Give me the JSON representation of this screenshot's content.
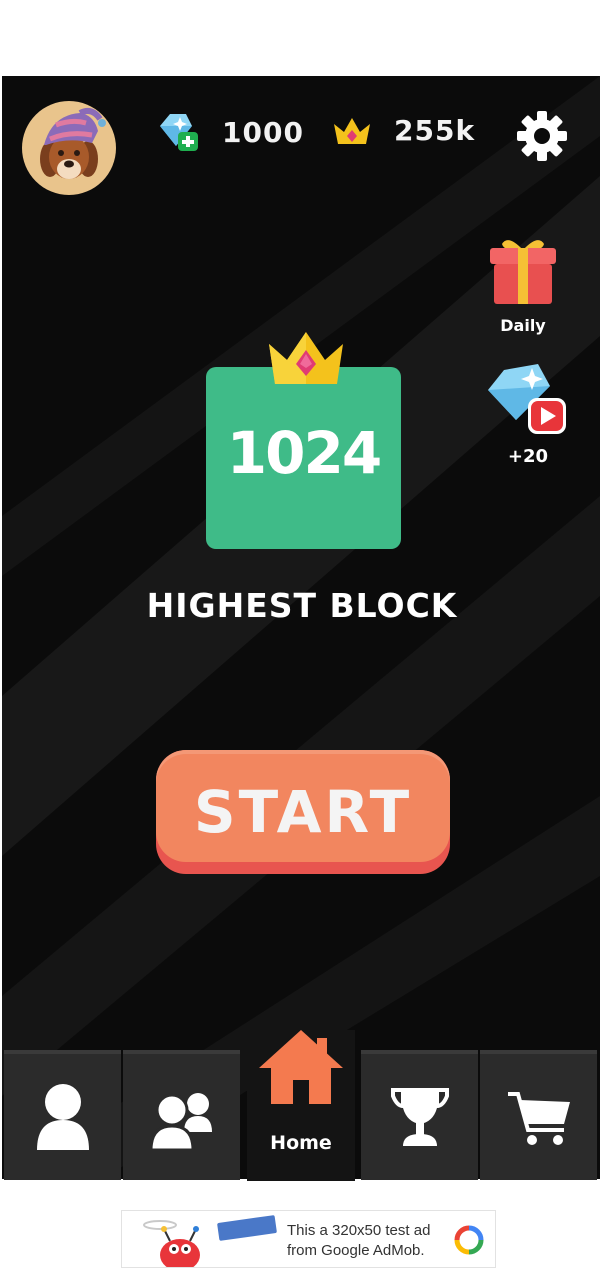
{
  "header": {
    "gems": "1000",
    "crowns": "255k"
  },
  "side": {
    "daily_label": "Daily",
    "reward_label": "+20"
  },
  "highest": {
    "block_value": "1024",
    "caption": "HIGHEST BLOCK"
  },
  "start_label": "START",
  "nav": {
    "home_label": "Home"
  },
  "ad": {
    "text": "This a 320x50 test ad from Google AdMob."
  },
  "colors": {
    "background": "#0b0b0b",
    "block": "#3fbb88",
    "start": "#f2865f",
    "start_shadow": "#e8554f",
    "nav": "#2b2b2b"
  }
}
